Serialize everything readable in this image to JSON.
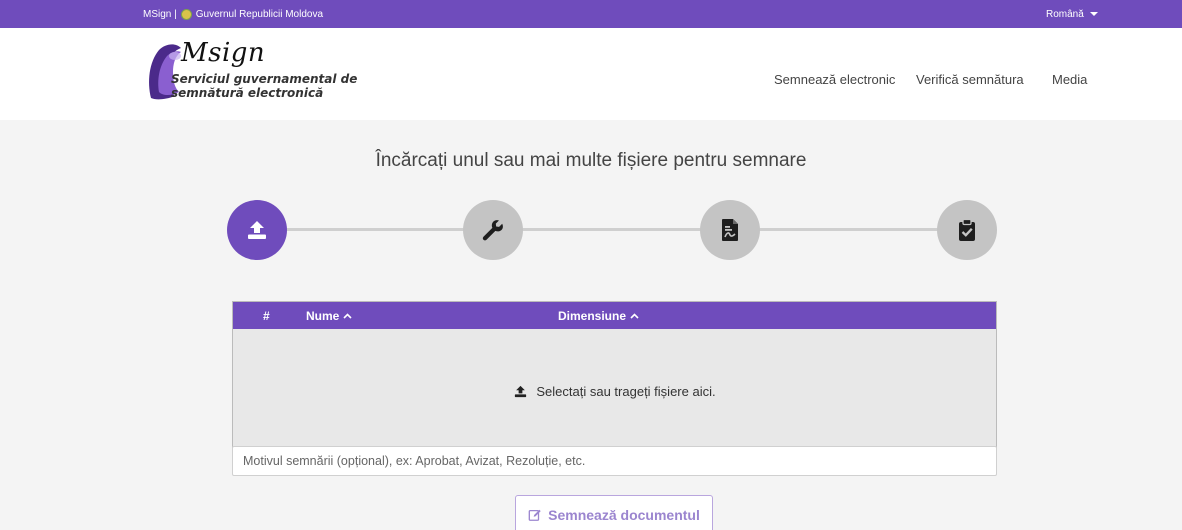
{
  "topbar": {
    "brand_prefix": "MSign | ",
    "government": "Guvernul Republicii Moldova",
    "language": "Română"
  },
  "logo": {
    "wordmark": "Msign",
    "tagline_line1": "Serviciul guvernamental de",
    "tagline_line2": "semnătură electronică"
  },
  "nav": {
    "sign": "Semnează electronic",
    "verify": "Verifică semnătura",
    "media": "Media"
  },
  "main": {
    "title": "Încărcați unul sau mai multe fișiere pentru semnare"
  },
  "steps": [
    {
      "icon": "upload-icon",
      "active": true
    },
    {
      "icon": "wrench-icon",
      "active": false
    },
    {
      "icon": "pdf-file-icon",
      "active": false
    },
    {
      "icon": "clipboard-check-icon",
      "active": false
    }
  ],
  "table": {
    "col_index": "#",
    "col_name": "Nume",
    "col_size": "Dimensiune",
    "dropzone_text": "Selectați sau trageți fișiere aici."
  },
  "reason": {
    "placeholder": "Motivul semnării (opțional), ex: Aprobat, Avizat, Rezoluție, etc."
  },
  "sign_button": {
    "label": "Semnează documentul"
  },
  "colors": {
    "primary": "#6f4cbc",
    "step_inactive": "#c4c4c4",
    "dropzone_bg": "#e8e8e8"
  }
}
